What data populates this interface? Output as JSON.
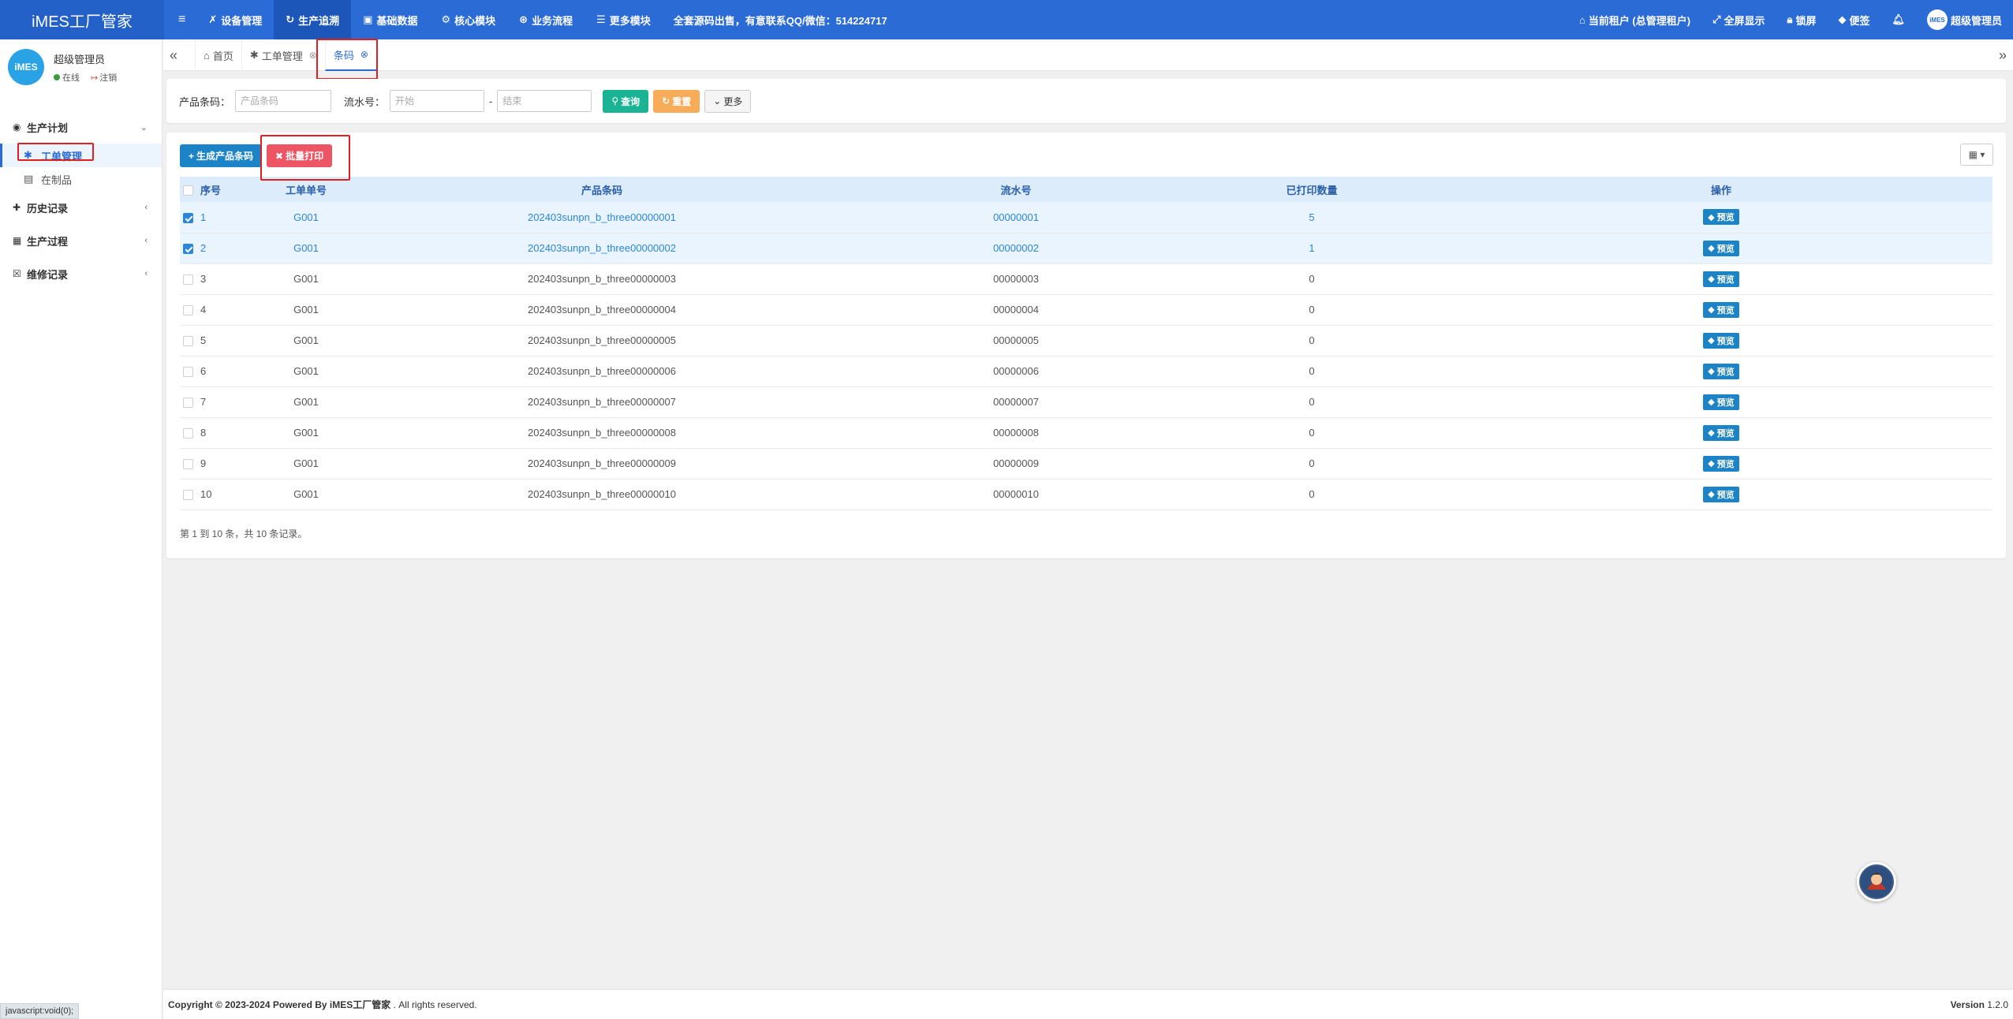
{
  "header": {
    "brand": "iMES工厂管家",
    "nav": [
      {
        "icon": "wrench-icon",
        "glyph": "✗",
        "label": "设备管理"
      },
      {
        "icon": "refresh-icon",
        "glyph": "↻",
        "label": "生产追溯"
      },
      {
        "icon": "user-book-icon",
        "glyph": "▣",
        "label": "基础数据"
      },
      {
        "icon": "gear-icon",
        "glyph": "⚙",
        "label": "核心模块"
      },
      {
        "icon": "cubes-icon",
        "glyph": "⊛",
        "label": "业务流程"
      },
      {
        "icon": "list-icon",
        "glyph": "☰",
        "label": "更多模块"
      }
    ],
    "notice": "全套源码出售，有意联系QQ/微信：514224717",
    "right": {
      "tenant": "当前租户 (总管理租户)",
      "fullscreen": "全屏显示",
      "lock": "锁屏",
      "tag": "便签",
      "avatar_text": "iMES",
      "user": "超级管理员"
    }
  },
  "sidebar": {
    "avatar_text": "iMES",
    "username": "超级管理员",
    "online": "在线",
    "logout": "注销",
    "items": [
      {
        "label": "生产计划",
        "arrow": "⌄"
      },
      {
        "label": "工单管理"
      },
      {
        "label": "在制品"
      },
      {
        "label": "历史记录",
        "arrow": "‹"
      },
      {
        "label": "生产过程",
        "arrow": "‹"
      },
      {
        "label": "维修记录",
        "arrow": "‹"
      }
    ]
  },
  "tabs": [
    {
      "label": "首页"
    },
    {
      "label": "工单管理"
    },
    {
      "label": "条码"
    }
  ],
  "search": {
    "barcode_label": "产品条码：",
    "barcode_placeholder": "产品条码",
    "serial_label": "流水号：",
    "start_placeholder": "开始",
    "sep": "-",
    "end_placeholder": "结束",
    "search_btn": "查询",
    "reset_btn": "重置",
    "more_btn": "更多"
  },
  "toolbar": {
    "generate_btn": "生成产品条码",
    "batch_print_btn": "批量打印"
  },
  "table": {
    "columns": [
      "序号",
      "工单单号",
      "产品条码",
      "流水号",
      "已打印数量",
      "操作"
    ],
    "action_label": "预览",
    "rows": [
      {
        "idx": "1",
        "order": "G001",
        "barcode": "202403sunpn_b_three00000001",
        "serial": "00000001",
        "printed": "5",
        "selected": true
      },
      {
        "idx": "2",
        "order": "G001",
        "barcode": "202403sunpn_b_three00000002",
        "serial": "00000002",
        "printed": "1",
        "selected": true
      },
      {
        "idx": "3",
        "order": "G001",
        "barcode": "202403sunpn_b_three00000003",
        "serial": "00000003",
        "printed": "0",
        "selected": false
      },
      {
        "idx": "4",
        "order": "G001",
        "barcode": "202403sunpn_b_three00000004",
        "serial": "00000004",
        "printed": "0",
        "selected": false
      },
      {
        "idx": "5",
        "order": "G001",
        "barcode": "202403sunpn_b_three00000005",
        "serial": "00000005",
        "printed": "0",
        "selected": false
      },
      {
        "idx": "6",
        "order": "G001",
        "barcode": "202403sunpn_b_three00000006",
        "serial": "00000006",
        "printed": "0",
        "selected": false
      },
      {
        "idx": "7",
        "order": "G001",
        "barcode": "202403sunpn_b_three00000007",
        "serial": "00000007",
        "printed": "0",
        "selected": false
      },
      {
        "idx": "8",
        "order": "G001",
        "barcode": "202403sunpn_b_three00000008",
        "serial": "00000008",
        "printed": "0",
        "selected": false
      },
      {
        "idx": "9",
        "order": "G001",
        "barcode": "202403sunpn_b_three00000009",
        "serial": "00000009",
        "printed": "0",
        "selected": false
      },
      {
        "idx": "10",
        "order": "G001",
        "barcode": "202403sunpn_b_three00000010",
        "serial": "00000010",
        "printed": "0",
        "selected": false
      }
    ],
    "pagination": "第 1 到 10 条，共 10 条记录。"
  },
  "footer": {
    "copyright_prefix": "Copyright © 2023-2024 Powered By iMES工厂管家",
    "copyright_suffix": " . All rights reserved.",
    "version_label": "Version",
    "version": "1.2.0"
  },
  "statusbar": "javascript:void(0);",
  "colors": {
    "primary": "#2b6bd6",
    "search_green": "#1ab394",
    "reset_orange": "#f8ac59",
    "danger_red": "#ed5565",
    "highlight_red": "#e02020"
  }
}
